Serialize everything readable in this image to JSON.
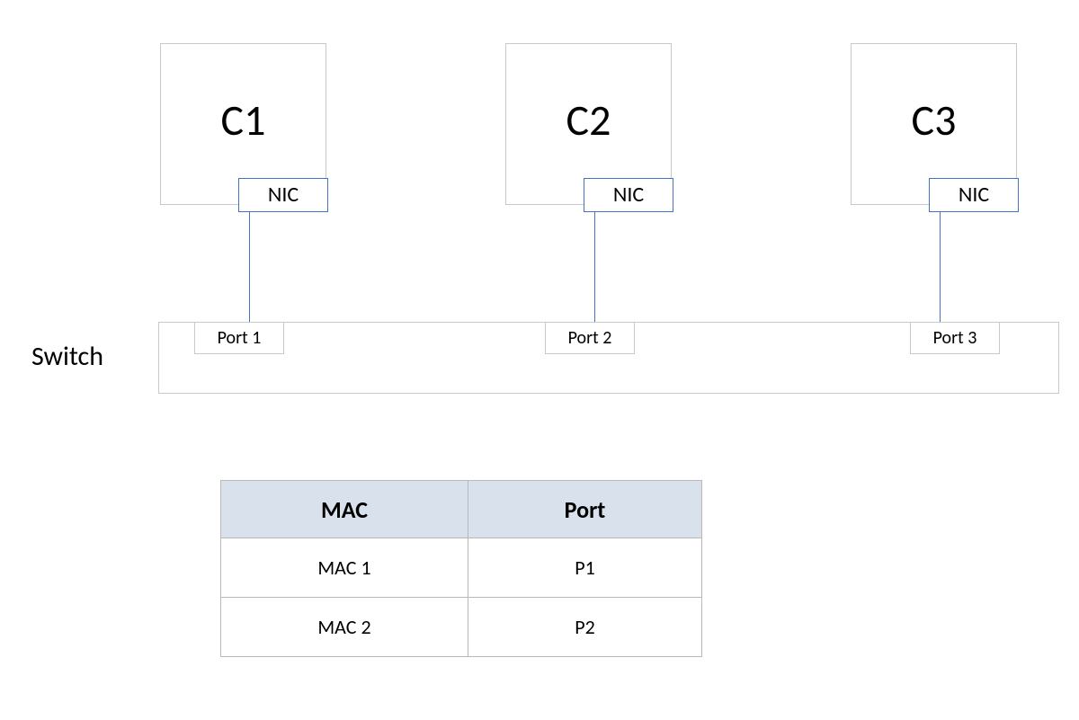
{
  "computers": [
    {
      "label": "C1",
      "nic": "NIC",
      "port": "Port 1"
    },
    {
      "label": "C2",
      "nic": "NIC",
      "port": "Port 2"
    },
    {
      "label": "C3",
      "nic": "NIC",
      "port": "Port 3"
    }
  ],
  "switch_label": "Switch",
  "table": {
    "headers": {
      "mac": "MAC",
      "port": "Port"
    },
    "rows": [
      {
        "mac": "MAC 1",
        "port": "P1"
      },
      {
        "mac": "MAC 2",
        "port": "P2"
      }
    ]
  }
}
